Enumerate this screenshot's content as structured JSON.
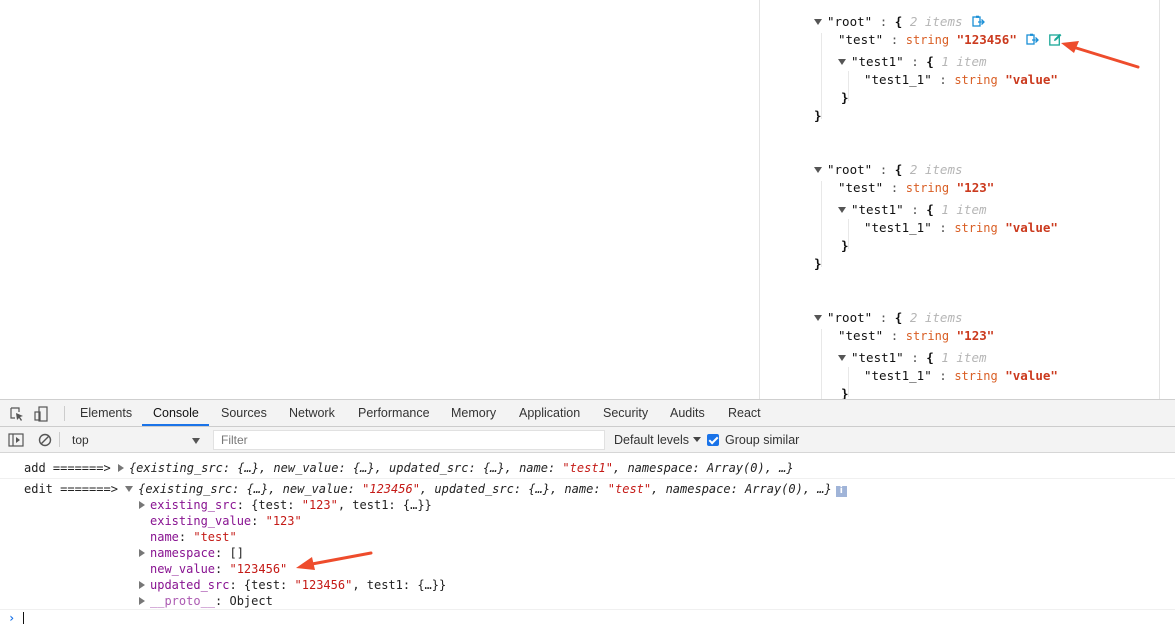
{
  "json_viewer": {
    "colors": {
      "key": "#111111",
      "type": "#d95e24",
      "string": "#cb3a1e",
      "count": "#b5b5b5",
      "edit_icon": "#1aa898"
    },
    "blocks": [
      {
        "root_key": "\"root\"",
        "open_brace": "{",
        "count": "2 items",
        "test_key": "\"test\"",
        "test_type": "string",
        "test_value": "\"123456\"",
        "test1_key": "\"test1\"",
        "test1_count": "1 item",
        "test1_1_key": "\"test1_1\"",
        "test1_1_type": "string",
        "test1_1_value": "\"value\"",
        "close_inner": "}",
        "close_outer": "}",
        "icons": [
          "copy-icon",
          "edit-icon"
        ]
      },
      {
        "root_key": "\"root\"",
        "open_brace": "{",
        "count": "2 items",
        "test_key": "\"test\"",
        "test_type": "string",
        "test_value": "\"123\"",
        "test1_key": "\"test1\"",
        "test1_count": "1 item",
        "test1_1_key": "\"test1_1\"",
        "test1_1_type": "string",
        "test1_1_value": "\"value\"",
        "close_inner": "}",
        "close_outer": "}"
      },
      {
        "root_key": "\"root\"",
        "open_brace": "{",
        "count": "2 items",
        "test_key": "\"test\"",
        "test_type": "string",
        "test_value": "\"123\"",
        "test1_key": "\"test1\"",
        "test1_count": "1 item",
        "test1_1_key": "\"test1_1\"",
        "test1_1_type": "string",
        "test1_1_value": "\"value\"",
        "close_inner": "}"
      }
    ],
    "colon": ":"
  },
  "devtools": {
    "accent": "#1a73e8",
    "tabs": [
      "Elements",
      "Console",
      "Sources",
      "Network",
      "Performance",
      "Memory",
      "Application",
      "Security",
      "Audits",
      "React"
    ],
    "active_tab": "Console",
    "context": "top",
    "filter_placeholder": "Filter",
    "levels": "Default levels",
    "group_similar": "Group similar",
    "group_similar_checked": true
  },
  "console": {
    "add": {
      "label": "add =======>",
      "p1": "{existing_src: {…}, new_value: {…}, updated_src: {…}, name: ",
      "name": "\"test1\"",
      "p2": ", namespace: Array(0), …}"
    },
    "edit": {
      "label": "edit =======>",
      "p1": "{existing_src: {…}, new_value: ",
      "new_value": "\"123456\"",
      "p2": ", updated_src: {…}, name: ",
      "name": "\"test\"",
      "p3": ", namespace: Array(0), …}",
      "info": "i",
      "props": {
        "existing_src": {
          "key": "existing_src",
          "p1": ": {test: ",
          "test": "\"123\"",
          "p2": ", test1: {…}}"
        },
        "existing_value": {
          "key": "existing_value",
          "sep": ": ",
          "value": "\"123\""
        },
        "name": {
          "key": "name",
          "sep": ": ",
          "value": "\"test\""
        },
        "namespace": {
          "key": "namespace",
          "value": ": []"
        },
        "new_value": {
          "key": "new_value",
          "sep": ": ",
          "value": "\"123456\""
        },
        "updated_src": {
          "key": "updated_src",
          "p1": ": {test: ",
          "test": "\"123456\"",
          "p2": ", test1: {…}}"
        },
        "proto": {
          "key": "__proto__",
          "value": ": Object"
        }
      }
    },
    "prompt": "›"
  },
  "annotations": {
    "arrow_color": "#ee4c2c",
    "arrows": [
      "arrow-to-edit-icon",
      "arrow-to-new-value"
    ]
  }
}
